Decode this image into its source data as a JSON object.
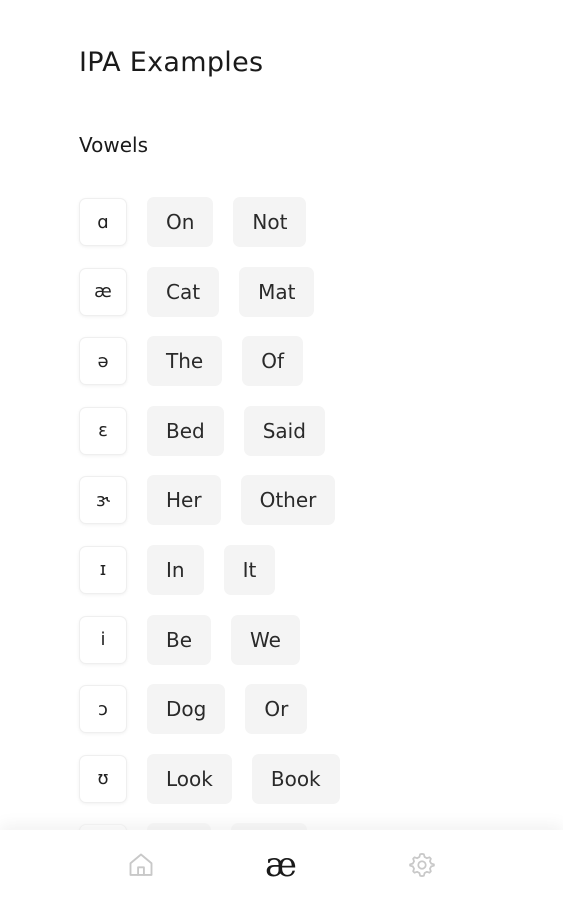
{
  "page": {
    "title": "IPA Examples"
  },
  "section": {
    "title": "Vowels"
  },
  "vowels": [
    {
      "symbol": "ɑ",
      "words": [
        "On",
        "Not"
      ]
    },
    {
      "symbol": "æ",
      "words": [
        "Cat",
        "Mat"
      ]
    },
    {
      "symbol": "ə",
      "words": [
        "The",
        "Of"
      ]
    },
    {
      "symbol": "ɛ",
      "words": [
        "Bed",
        "Said"
      ]
    },
    {
      "symbol": "ɝ",
      "words": [
        "Her",
        "Other"
      ]
    },
    {
      "symbol": "ɪ",
      "words": [
        "In",
        "It"
      ]
    },
    {
      "symbol": "i",
      "words": [
        "Be",
        "We"
      ]
    },
    {
      "symbol": "ɔ",
      "words": [
        "Dog",
        "Or"
      ]
    },
    {
      "symbol": "ʊ",
      "words": [
        "Look",
        "Book"
      ]
    }
  ],
  "bottom_nav": {
    "items": [
      {
        "icon": "home-icon",
        "active": false
      },
      {
        "icon": "ipa-ae-icon",
        "label": "æ",
        "active": true
      },
      {
        "icon": "gear-icon",
        "active": false
      }
    ]
  },
  "colors": {
    "active_icon": "#1a1a1a",
    "inactive_icon": "#c8c8c8",
    "chip_background": "#f4f4f4",
    "symbol_border": "#efefef"
  }
}
